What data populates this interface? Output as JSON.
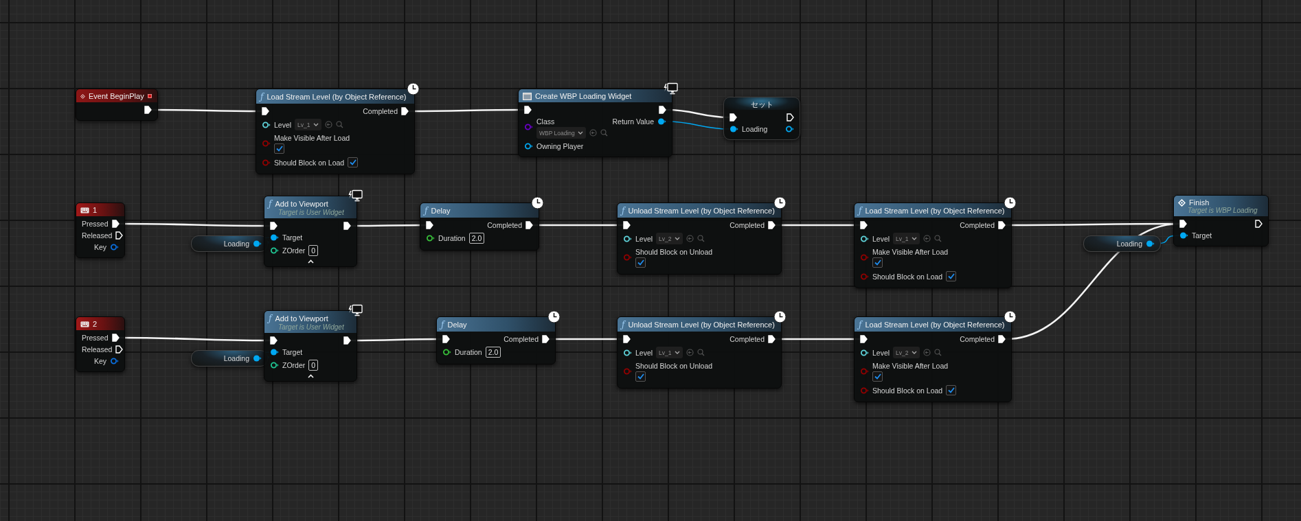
{
  "nodes": [
    {
      "kind": "event",
      "title": "Event BeginPlay",
      "delegate": true,
      "rows": [
        {
          "out": {
            "kind": "exec",
            "connected": true
          }
        }
      ]
    },
    {
      "kind": "latent_function",
      "glyph": "ƒ",
      "title": "Load Stream Level (by Object Reference)",
      "rows": [
        {
          "in": {
            "kind": "exec",
            "connected": true
          },
          "out": {
            "kind": "exec",
            "label": "Completed",
            "connected": true
          }
        },
        {
          "in": {
            "kind": "level",
            "label": "Level",
            "value": "Lv_1",
            "connected": false
          }
        },
        {
          "in": {
            "kind": "bool",
            "label": "Make Visible After Load",
            "checked": true,
            "connected": false
          }
        },
        {
          "in": {
            "kind": "bool",
            "label": "Should Block on Load",
            "checked": true,
            "connected": false
          }
        }
      ]
    },
    {
      "kind": "create_widget",
      "title": "Create WBP Loading Widget",
      "rows": [
        {
          "in": {
            "kind": "exec",
            "connected": true
          },
          "out": {
            "kind": "exec",
            "connected": true
          }
        },
        {
          "in": {
            "kind": "class",
            "label": "Class",
            "value": "WBP Loading",
            "connected": false
          },
          "out": {
            "kind": "object",
            "label": "Return Value",
            "connected": true
          }
        },
        {
          "in": {
            "kind": "object",
            "label": "Owning Player",
            "connected": false
          }
        }
      ]
    },
    {
      "kind": "setter",
      "title": "セット",
      "rows": [
        {
          "in": {
            "kind": "exec",
            "connected": true
          },
          "out": {
            "kind": "exec",
            "connected": false
          }
        },
        {
          "in": {
            "kind": "object",
            "label": "Loading",
            "connected": true
          },
          "out": {
            "kind": "object",
            "connected": false
          }
        }
      ]
    },
    {
      "kind": "key_event",
      "title": "1",
      "rows": [
        {
          "out": {
            "kind": "exec",
            "label": "Pressed",
            "connected": true
          }
        },
        {
          "out": {
            "kind": "exec",
            "label": "Released",
            "connected": false
          }
        },
        {
          "out": {
            "kind": "struct",
            "label": "Key",
            "connected": false
          }
        }
      ]
    },
    {
      "kind": "variable",
      "rows": [
        {
          "out": {
            "kind": "object",
            "label": "Loading",
            "connected": true
          }
        }
      ]
    },
    {
      "kind": "widget_function",
      "glyph": "ƒ",
      "title": "Add to Viewport",
      "subtitle": "Target is User Widget",
      "advanced": true,
      "rows": [
        {
          "in": {
            "kind": "exec",
            "connected": true
          },
          "out": {
            "kind": "exec",
            "connected": true
          }
        },
        {
          "in": {
            "kind": "object",
            "label": "Target",
            "connected": true
          }
        },
        {
          "in": {
            "kind": "int",
            "label": "ZOrder",
            "value": "0",
            "connected": false
          }
        }
      ]
    },
    {
      "kind": "latent_function",
      "glyph": "ƒ",
      "title": "Delay",
      "rows": [
        {
          "in": {
            "kind": "exec",
            "connected": true
          },
          "out": {
            "kind": "exec",
            "label": "Completed",
            "connected": true
          }
        },
        {
          "in": {
            "kind": "float",
            "label": "Duration",
            "value": "2.0",
            "connected": false
          }
        }
      ]
    },
    {
      "kind": "latent_function",
      "glyph": "ƒ",
      "title": "Unload Stream Level (by Object Reference)",
      "rows": [
        {
          "in": {
            "kind": "exec",
            "connected": true
          },
          "out": {
            "kind": "exec",
            "label": "Completed",
            "connected": true
          }
        },
        {
          "in": {
            "kind": "level",
            "label": "Level",
            "value": "Lv_2",
            "connected": false
          }
        },
        {
          "in": {
            "kind": "bool",
            "label": "Should Block on Unload",
            "checked": true,
            "connected": false
          }
        }
      ]
    },
    {
      "kind": "latent_function",
      "glyph": "ƒ",
      "title": "Load Stream Level (by Object Reference)",
      "rows": [
        {
          "in": {
            "kind": "exec",
            "connected": true
          },
          "out": {
            "kind": "exec",
            "label": "Completed",
            "connected": true
          }
        },
        {
          "in": {
            "kind": "level",
            "label": "Level",
            "value": "Lv_1",
            "connected": false
          }
        },
        {
          "in": {
            "kind": "bool",
            "label": "Make Visible After Load",
            "checked": true,
            "connected": false
          }
        },
        {
          "in": {
            "kind": "bool",
            "label": "Should Block on Load",
            "checked": true,
            "connected": false
          }
        }
      ]
    },
    {
      "kind": "variable",
      "rows": [
        {
          "out": {
            "kind": "object",
            "label": "Loading",
            "connected": true
          }
        }
      ]
    },
    {
      "kind": "event_call",
      "title": "Finish",
      "subtitle": "Target is WBP Loading",
      "rows": [
        {
          "in": {
            "kind": "exec",
            "connected": true
          },
          "out": {
            "kind": "exec",
            "connected": false
          }
        },
        {
          "in": {
            "kind": "object",
            "label": "Target",
            "connected": true
          }
        }
      ]
    },
    {
      "kind": "key_event",
      "title": "2",
      "rows": [
        {
          "out": {
            "kind": "exec",
            "label": "Pressed",
            "connected": true
          }
        },
        {
          "out": {
            "kind": "exec",
            "label": "Released",
            "connected": false
          }
        },
        {
          "out": {
            "kind": "struct",
            "label": "Key",
            "connected": false
          }
        }
      ]
    },
    {
      "kind": "variable",
      "rows": [
        {
          "out": {
            "kind": "object",
            "label": "Loading",
            "connected": true
          }
        }
      ]
    },
    {
      "kind": "widget_function",
      "glyph": "ƒ",
      "title": "Add to Viewport",
      "subtitle": "Target is User Widget",
      "advanced": true,
      "rows": [
        {
          "in": {
            "kind": "exec",
            "connected": true
          },
          "out": {
            "kind": "exec",
            "connected": true
          }
        },
        {
          "in": {
            "kind": "object",
            "label": "Target",
            "connected": true
          }
        },
        {
          "in": {
            "kind": "int",
            "label": "ZOrder",
            "value": "0",
            "connected": false
          }
        }
      ]
    },
    {
      "kind": "latent_function",
      "glyph": "ƒ",
      "title": "Delay",
      "rows": [
        {
          "in": {
            "kind": "exec",
            "connected": true
          },
          "out": {
            "kind": "exec",
            "label": "Completed",
            "connected": true
          }
        },
        {
          "in": {
            "kind": "float",
            "label": "Duration",
            "value": "2.0",
            "connected": false
          }
        }
      ]
    },
    {
      "kind": "latent_function",
      "glyph": "ƒ",
      "title": "Unload Stream Level (by Object Reference)",
      "rows": [
        {
          "in": {
            "kind": "exec",
            "connected": true
          },
          "out": {
            "kind": "exec",
            "label": "Completed",
            "connected": true
          }
        },
        {
          "in": {
            "kind": "level",
            "label": "Level",
            "value": "Lv_1",
            "connected": false
          }
        },
        {
          "in": {
            "kind": "bool",
            "label": "Should Block on Unload",
            "checked": true,
            "connected": false
          }
        }
      ]
    },
    {
      "kind": "latent_function",
      "glyph": "ƒ",
      "title": "Load Stream Level (by Object Reference)",
      "rows": [
        {
          "in": {
            "kind": "exec",
            "connected": true
          },
          "out": {
            "kind": "exec",
            "label": "Completed",
            "connected": true
          }
        },
        {
          "in": {
            "kind": "level",
            "label": "Level",
            "value": "Lv_2",
            "connected": false
          }
        },
        {
          "in": {
            "kind": "bool",
            "label": "Make Visible After Load",
            "checked": true,
            "connected": false
          }
        },
        {
          "in": {
            "kind": "bool",
            "label": "Should Block on Load",
            "checked": true,
            "connected": false
          }
        }
      ]
    }
  ]
}
